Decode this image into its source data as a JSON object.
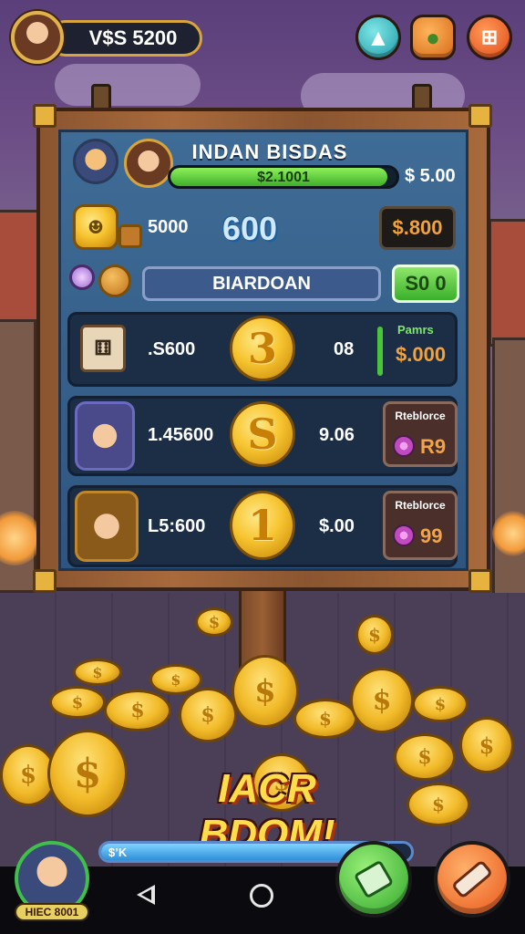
{
  "player": {
    "currency": "V$S 5200"
  },
  "top_buttons": {
    "upgrade_icon": "up-arrow-icon",
    "map_icon": "map-icon",
    "menu_icon": "menu-grid-icon"
  },
  "board": {
    "hero_name": "INDAN BISDAS",
    "xp_label": "$2.1001",
    "xp_fraction": 0.96,
    "balance": "$ 5.00",
    "pet_count": "5000",
    "gem_count": "600",
    "gem_price": "$.800",
    "name_field": "BIARDOAN",
    "confirm_label": "S0 0",
    "rows": [
      {
        "amount": ".S600",
        "coin_symbol": "3",
        "value": "08",
        "side_title": "Pamrs",
        "side_price": "$.000"
      },
      {
        "amount": "1.45600",
        "coin_symbol": "S",
        "value": "9.06",
        "side_title": "Rteblorce",
        "side_value": "R9"
      },
      {
        "amount": "L5:600",
        "coin_symbol": "1",
        "value": "$.00",
        "side_title": "Rteblorce",
        "side_value": "99"
      }
    ]
  },
  "banner": "IACR BDOM!",
  "bottom": {
    "player_tag": "HIEC 8001",
    "progress_label": "$’K",
    "progress_fraction": 0.93,
    "left_button_icon": "gem-stack-icon",
    "right_button_icon": "hammer-icon"
  },
  "colors": {
    "gold": "#f7c531",
    "board_blue": "#3f6c96",
    "xp_green": "#3fae2a",
    "confirm_green": "#4ec23a",
    "orange": "#f06a1e"
  }
}
